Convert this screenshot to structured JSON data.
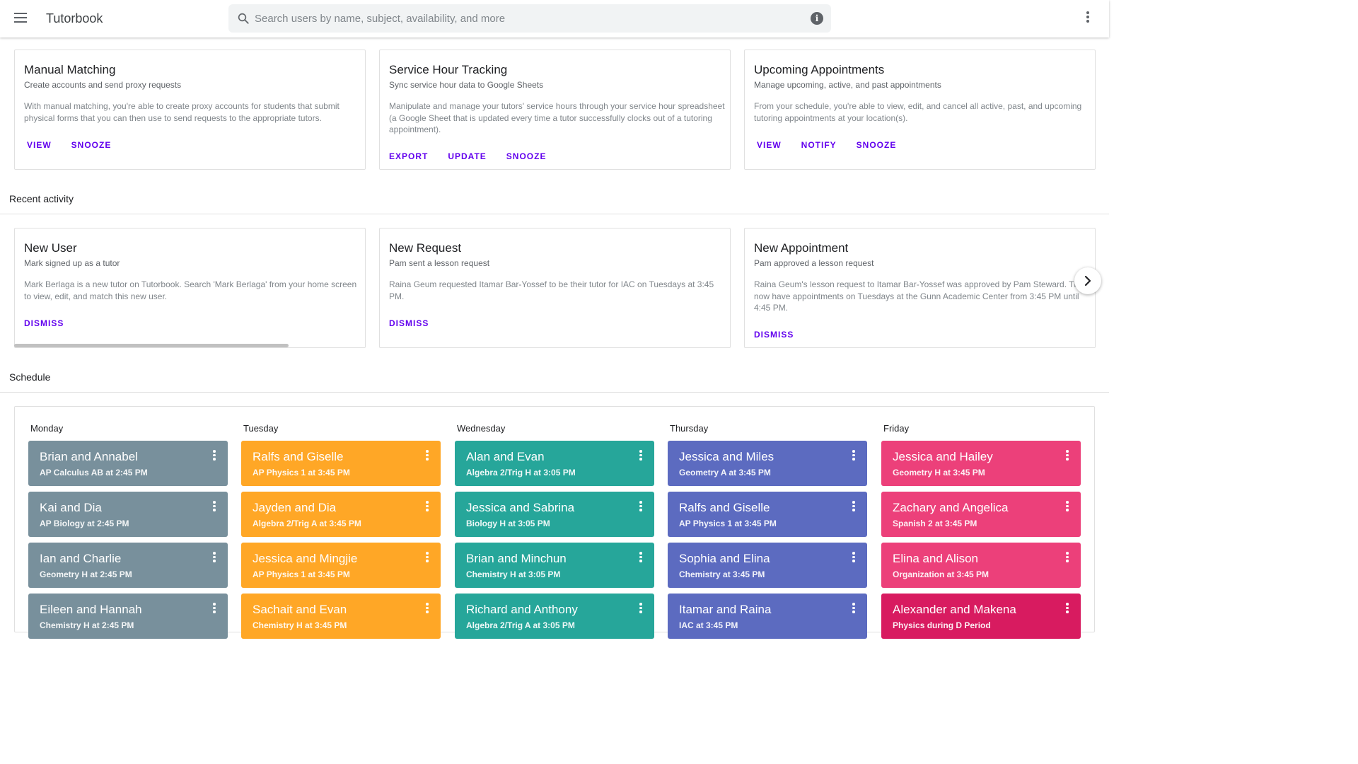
{
  "app": {
    "title": "Tutorbook",
    "search_placeholder": "Search users by name, subject, availability, and more"
  },
  "icons": {
    "menu": "menu-icon",
    "search": "search-icon",
    "info": "info-icon",
    "info_glyph": "i",
    "more": "more-vert-icon",
    "next": "chevron-right-icon"
  },
  "colors": {
    "accent": "#6200ee",
    "monday": "#78909c",
    "tuesday": "#ffa726",
    "wednesday": "#26a69a",
    "thursday": "#5c6bc0",
    "friday": "#ec407a",
    "friday_dark": "#d81b60"
  },
  "dashboard_cards": [
    {
      "title": "Manual Matching",
      "subtitle": "Create accounts and send proxy requests",
      "body": "With manual matching, you're able to create proxy accounts for students that submit physical forms that you can then use to send requests to the appropriate tutors.",
      "actions": [
        "VIEW",
        "SNOOZE"
      ]
    },
    {
      "title": "Service Hour Tracking",
      "subtitle": "Sync service hour data to Google Sheets",
      "body": "Manipulate and manage your tutors' service hours through your service hour spreadsheet (a Google Sheet that is updated every time a tutor successfully clocks out of a tutoring appointment).",
      "actions": [
        "EXPORT",
        "UPDATE",
        "SNOOZE"
      ]
    },
    {
      "title": "Upcoming Appointments",
      "subtitle": "Manage upcoming, active, and past appointments",
      "body": "From your schedule, you're able to view, edit, and cancel all active, past, and upcoming tutoring appointments at your location(s).",
      "actions": [
        "VIEW",
        "NOTIFY",
        "SNOOZE"
      ]
    }
  ],
  "recent_activity": {
    "header": "Recent activity",
    "cards": [
      {
        "title": "New User",
        "subtitle": "Mark signed up as a tutor",
        "body": "Mark Berlaga is a new tutor on Tutorbook. Search 'Mark Berlaga' from your home screen to view, edit, and match this new user.",
        "actions": [
          "DISMISS"
        ]
      },
      {
        "title": "New Request",
        "subtitle": "Pam sent a lesson request",
        "body": "Raina Geum requested Itamar Bar-Yossef to be their tutor for IAC on Tuesdays at 3:45 PM.",
        "actions": [
          "DISMISS"
        ]
      },
      {
        "title": "New Appointment",
        "subtitle": "Pam approved a lesson request",
        "body": "Raina Geum's lesson request to Itamar Bar-Yossef was approved by Pam Steward. They now have appointments on Tuesdays at the Gunn Academic Center from 3:45 PM until 4:45 PM.",
        "actions": [
          "DISMISS"
        ]
      }
    ]
  },
  "schedule": {
    "header": "Schedule",
    "days": [
      {
        "name": "Monday",
        "appointments": [
          {
            "title": "Brian and Annabel",
            "detail": "AP Calculus AB at 2:45 PM"
          },
          {
            "title": "Kai and Dia",
            "detail": "AP Biology at 2:45 PM"
          },
          {
            "title": "Ian and Charlie",
            "detail": "Geometry H at 2:45 PM"
          },
          {
            "title": "Eileen and Hannah",
            "detail": "Chemistry H at 2:45 PM"
          }
        ]
      },
      {
        "name": "Tuesday",
        "appointments": [
          {
            "title": "Ralfs and Giselle",
            "detail": "AP Physics 1 at 3:45 PM"
          },
          {
            "title": "Jayden and Dia",
            "detail": "Algebra 2/Trig A at 3:45 PM"
          },
          {
            "title": "Jessica and Mingjie",
            "detail": "AP Physics 1 at 3:45 PM"
          },
          {
            "title": "Sachait and Evan",
            "detail": "Chemistry H at 3:45 PM"
          }
        ]
      },
      {
        "name": "Wednesday",
        "appointments": [
          {
            "title": "Alan and Evan",
            "detail": "Algebra 2/Trig H at 3:05 PM"
          },
          {
            "title": "Jessica and Sabrina",
            "detail": "Biology H at 3:05 PM"
          },
          {
            "title": "Brian and Minchun",
            "detail": "Chemistry H at 3:05 PM"
          },
          {
            "title": "Richard and Anthony",
            "detail": "Algebra 2/Trig A at 3:05 PM"
          }
        ]
      },
      {
        "name": "Thursday",
        "appointments": [
          {
            "title": "Jessica and Miles",
            "detail": "Geometry A at 3:45 PM"
          },
          {
            "title": "Ralfs and Giselle",
            "detail": "AP Physics 1 at 3:45 PM"
          },
          {
            "title": "Sophia and Elina",
            "detail": "Chemistry at 3:45 PM"
          },
          {
            "title": "Itamar and Raina",
            "detail": "IAC at 3:45 PM"
          }
        ]
      },
      {
        "name": "Friday",
        "appointments": [
          {
            "title": "Jessica and Hailey",
            "detail": "Geometry H at 3:45 PM"
          },
          {
            "title": "Zachary and Angelica",
            "detail": "Spanish 2 at 3:45 PM"
          },
          {
            "title": "Elina and Alison",
            "detail": "Organization at 3:45 PM"
          },
          {
            "title": "Alexander and Makena",
            "detail": "Physics during D Period"
          }
        ]
      }
    ]
  }
}
